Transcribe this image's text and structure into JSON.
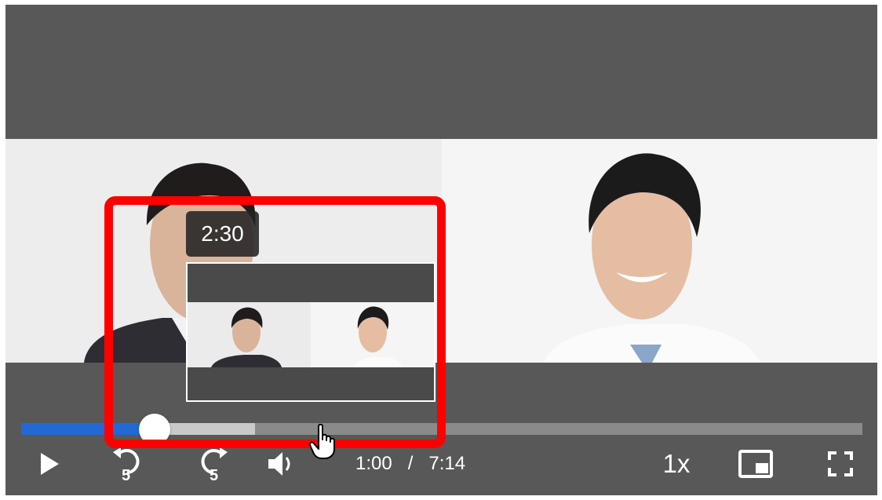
{
  "player": {
    "current_time": "1:00",
    "separator": "/",
    "duration": "7:14",
    "playback_speed": "1x",
    "progress_fraction": 0.144,
    "buffered_fraction": 0.278,
    "hover_time": "2:30"
  },
  "icons": {
    "play": "play-icon",
    "rewind": "rewind-5-icon",
    "forward": "forward-5-icon",
    "volume": "volume-icon",
    "pip": "picture-in-picture-icon",
    "fullscreen": "fullscreen-icon",
    "cursor": "hand-pointer-icon"
  },
  "colors": {
    "player_background": "#585858",
    "progress_played": "#2269d6",
    "progress_buffered": "#c9c9c9",
    "progress_track": "#8a8a8a",
    "annotation": "#ff0000"
  }
}
